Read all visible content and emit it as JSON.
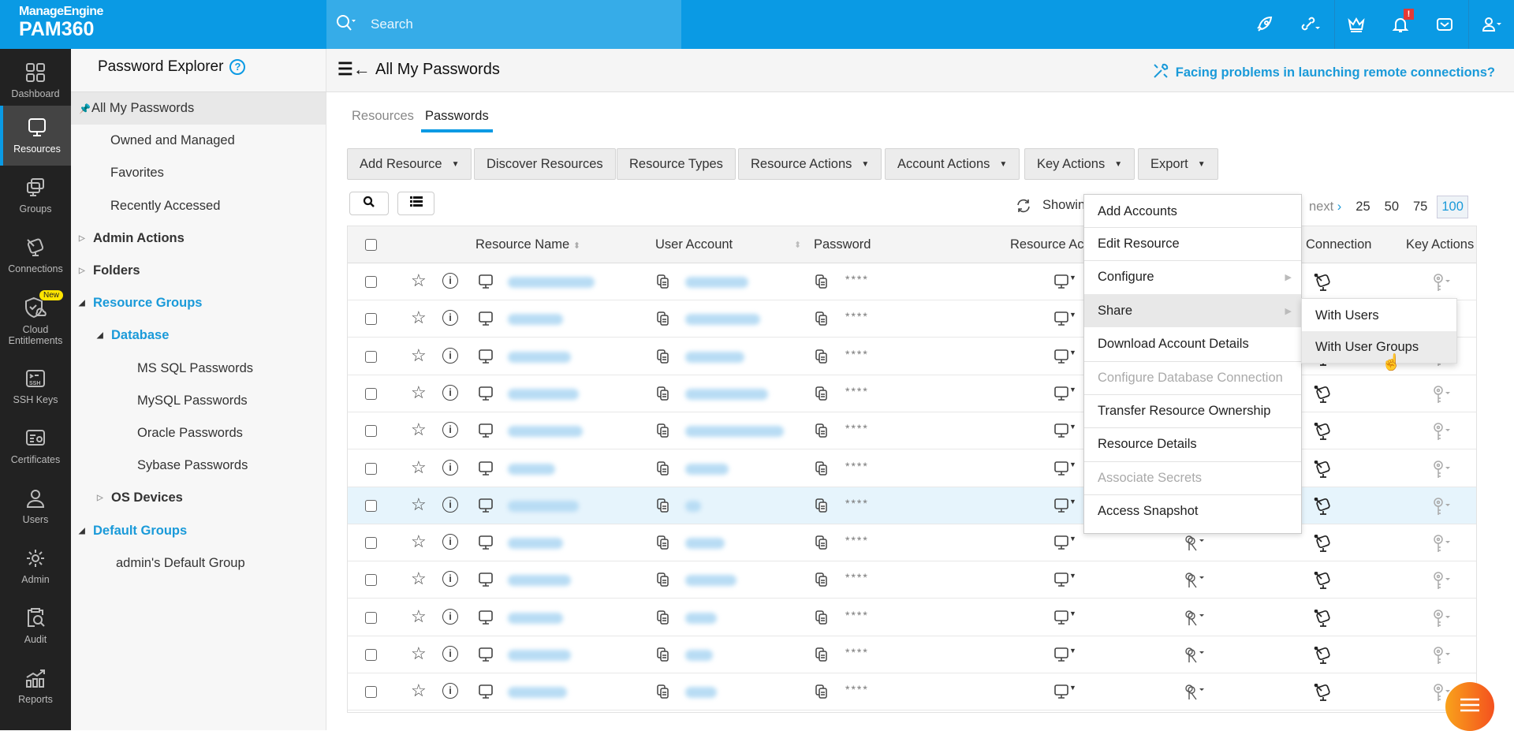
{
  "brand": {
    "vendor": "ManageEngine",
    "product": "PAM360"
  },
  "search": {
    "placeholder": "Search"
  },
  "topbar": {
    "icons": [
      "rocket-icon",
      "link-icon",
      "crown-icon",
      "bell-icon",
      "mail-icon",
      "user-icon"
    ],
    "notification_badge": "!"
  },
  "rail": {
    "items": [
      {
        "label": "Dashboard",
        "icon": "dashboard-icon"
      },
      {
        "label": "Resources",
        "icon": "monitor-icon",
        "active": true
      },
      {
        "label": "Groups",
        "icon": "groups-icon"
      },
      {
        "label": "Connections",
        "icon": "connections-icon"
      },
      {
        "label": "Cloud Entitlements",
        "icon": "cloud-shield-icon",
        "badge": "New"
      },
      {
        "label": "SSH Keys",
        "icon": "ssh-icon"
      },
      {
        "label": "Certificates",
        "icon": "certificate-icon"
      },
      {
        "label": "Users",
        "icon": "user-icon"
      },
      {
        "label": "Admin",
        "icon": "gear-icon"
      },
      {
        "label": "Audit",
        "icon": "audit-icon"
      },
      {
        "label": "Reports",
        "icon": "reports-icon"
      }
    ]
  },
  "tree": {
    "title": "Password Explorer",
    "items": [
      {
        "label": "All My Passwords",
        "selected": true
      },
      {
        "label": "Owned and Managed"
      },
      {
        "label": "Favorites"
      },
      {
        "label": "Recently Accessed"
      },
      {
        "label": "Admin Actions",
        "expander": "closed"
      },
      {
        "label": "Folders",
        "expander": "closed"
      },
      {
        "label": "Resource Groups",
        "expander": "open"
      },
      {
        "label": "Database",
        "expander": "open"
      },
      {
        "label": "MS SQL Passwords"
      },
      {
        "label": "MySQL Passwords"
      },
      {
        "label": "Oracle Passwords"
      },
      {
        "label": "Sybase Passwords"
      },
      {
        "label": "OS Devices",
        "expander": "closed"
      },
      {
        "label": "Default Groups",
        "expander": "open"
      },
      {
        "label": "admin's Default Group"
      }
    ]
  },
  "header": {
    "title": "All My Passwords",
    "help_link": "Facing problems in launching remote connections?"
  },
  "tabs": [
    {
      "label": "Resources"
    },
    {
      "label": "Passwords",
      "active": true
    }
  ],
  "toolbar": {
    "add_resource": "Add Resource",
    "discover": "Discover Resources",
    "types": "Resource Types",
    "resource_actions": "Resource Actions",
    "account_actions": "Account Actions",
    "key_actions": "Key Actions",
    "export": "Export"
  },
  "pager": {
    "showing": "Showin",
    "next": "next",
    "sizes": [
      "25",
      "50",
      "75",
      "100"
    ],
    "selected": "100"
  },
  "table": {
    "columns": {
      "resource_name": "Resource Name",
      "user_account": "User Account",
      "password": "Password",
      "resource_actions": "Resource Ac",
      "connection": "Connection",
      "key_actions": "Key Actions"
    },
    "rows": [
      {
        "password": "****"
      },
      {
        "password": "****"
      },
      {
        "password": "****"
      },
      {
        "password": "****"
      },
      {
        "password": "****"
      },
      {
        "password": "****"
      },
      {
        "password": "****",
        "highlighted": true
      },
      {
        "password": "****"
      },
      {
        "password": "****"
      },
      {
        "password": "****"
      },
      {
        "password": "****"
      },
      {
        "password": "****"
      }
    ]
  },
  "context_menu": {
    "items": [
      {
        "label": "Add Accounts"
      },
      {
        "label": "Edit Resource"
      },
      {
        "label": "Configure",
        "submenu": true
      },
      {
        "label": "Share",
        "submenu": true,
        "hovered": true
      },
      {
        "label": "Download Account Details"
      },
      {
        "label": "Configure Database Connection",
        "disabled": true
      },
      {
        "label": "Transfer Resource Ownership"
      },
      {
        "label": "Resource Details"
      },
      {
        "label": "Associate Secrets",
        "disabled": true
      },
      {
        "label": "Access Snapshot"
      }
    ]
  },
  "submenu": {
    "items": [
      {
        "label": "With Users"
      },
      {
        "label": "With User Groups",
        "hovered": true
      }
    ]
  },
  "colors": {
    "brand_blue": "#0a9ae4",
    "link_blue": "#1a9ad9",
    "rail": "#222222",
    "fab": "#f4511e"
  }
}
